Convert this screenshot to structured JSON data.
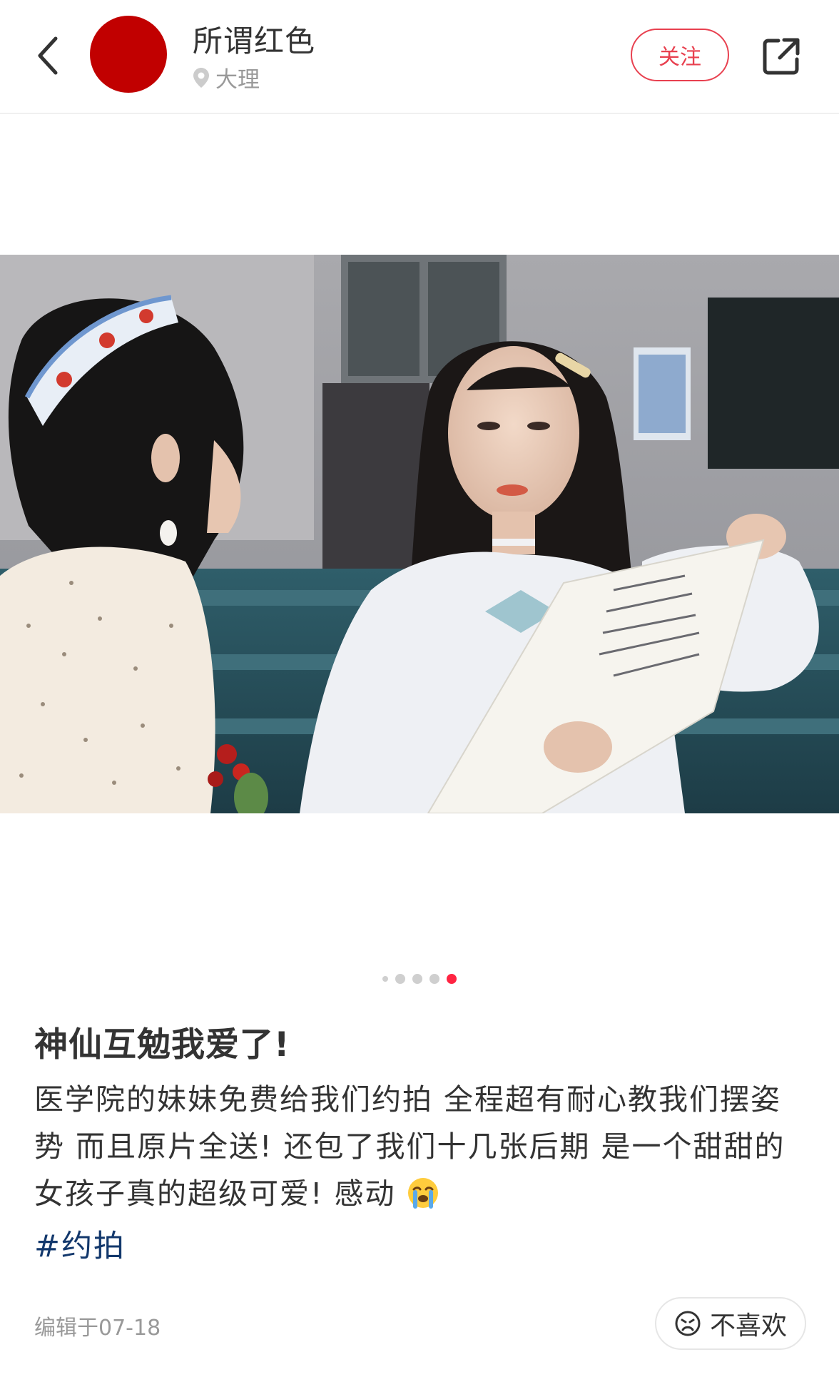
{
  "header": {
    "username": "所谓红色",
    "location": "大理",
    "follow_label": "关注",
    "avatar_color": "#c10000"
  },
  "carousel": {
    "total": 5,
    "active_index": 4
  },
  "post": {
    "title": "神仙互勉我爱了!",
    "body": "医学院的妹妹免费给我们约拍 全程超有耐心教我们摆姿势 而且原片全送! 还包了我们十几张后期 是一个甜甜的女孩子真的超级可爱! 感动",
    "hashtag": "#约拍",
    "edited": "编辑于07-18"
  },
  "actions": {
    "dislike_label": "不喜欢"
  },
  "colors": {
    "accent": "#ff2442",
    "follow_border": "#e8404f",
    "hashtag": "#13386c",
    "muted": "#999999"
  }
}
